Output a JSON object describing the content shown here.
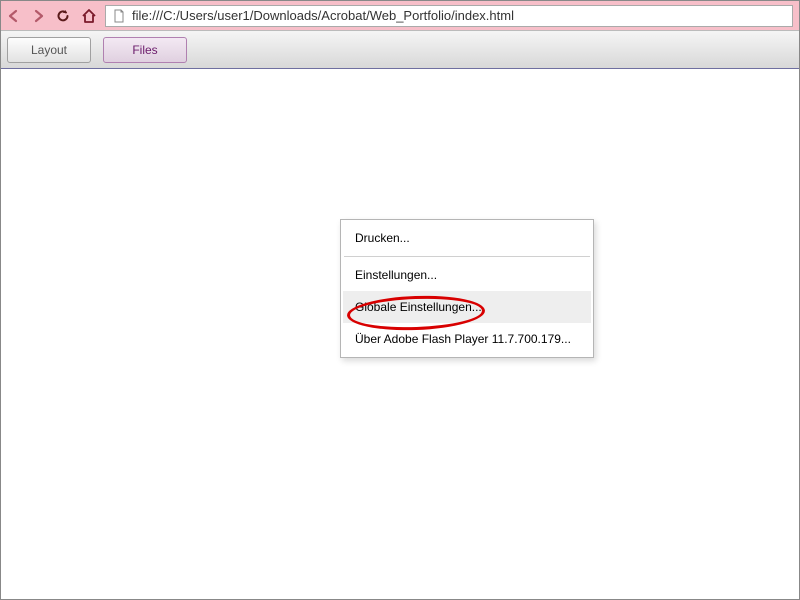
{
  "browser": {
    "url": "file:///C:/Users/user1/Downloads/Acrobat/Web_Portfolio/index.html"
  },
  "toolbar": {
    "layout_label": "Layout",
    "files_label": "Files"
  },
  "context_menu": {
    "print": "Drucken...",
    "settings": "Einstellungen...",
    "global_settings": "Globale Einstellungen...",
    "about": "Über Adobe Flash Player 11.7.700.179..."
  }
}
